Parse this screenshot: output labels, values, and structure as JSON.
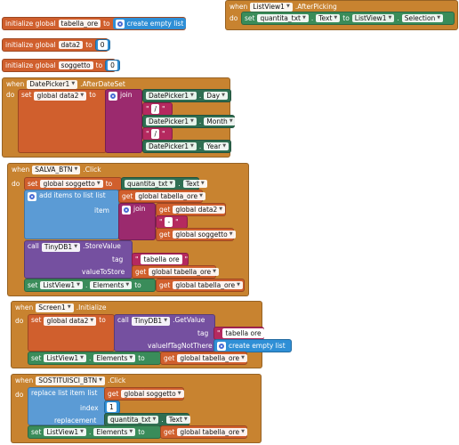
{
  "kw": {
    "when": "when",
    "do": "do",
    "set": "set",
    "to": "to",
    "call": "call",
    "get": "get",
    "join": "join",
    "item": "item",
    "tag": "tag",
    "initialize_global": "initialize global",
    "add_items": "add items to list",
    "list": "list",
    "value_to_store": "valueToStore",
    "value_if_tag_not_there": "valueIfTagNotThere",
    "replace": "replace list item",
    "index": "index",
    "replacement": "replacement",
    "empty_list": "create empty list"
  },
  "var": {
    "tabella": "tabella_ore",
    "data2": "data2",
    "soggetto": "soggetto",
    "global_data2": "global data2",
    "global_soggetto": "global soggetto",
    "global_tabella": "global tabella_ore"
  },
  "comp": {
    "listview": "ListView1",
    "datepicker": "DatePicker1",
    "salva": "SALVA_BTN",
    "tinydb": "TinyDB1",
    "screen": "Screen1",
    "sostituisci": "SOSTITUISCI_BTN",
    "quantita": "quantita_txt"
  },
  "ev": {
    "after_picking": ".AfterPicking",
    "after_date_set": ".AfterDateSet",
    "click": ".Click",
    "initialize": ".Initialize"
  },
  "prop": {
    "text": "Text",
    "selection": "Selection",
    "day": "Day",
    "month": "Month",
    "year": "Year",
    "elements": "Elements"
  },
  "method": {
    "store": ".StoreValue",
    "get": ".GetValue"
  },
  "lit": {
    "slash": "/",
    "dash": "-",
    "tabella_ore": "tabella ore",
    "zero": "0",
    "one": "1"
  }
}
